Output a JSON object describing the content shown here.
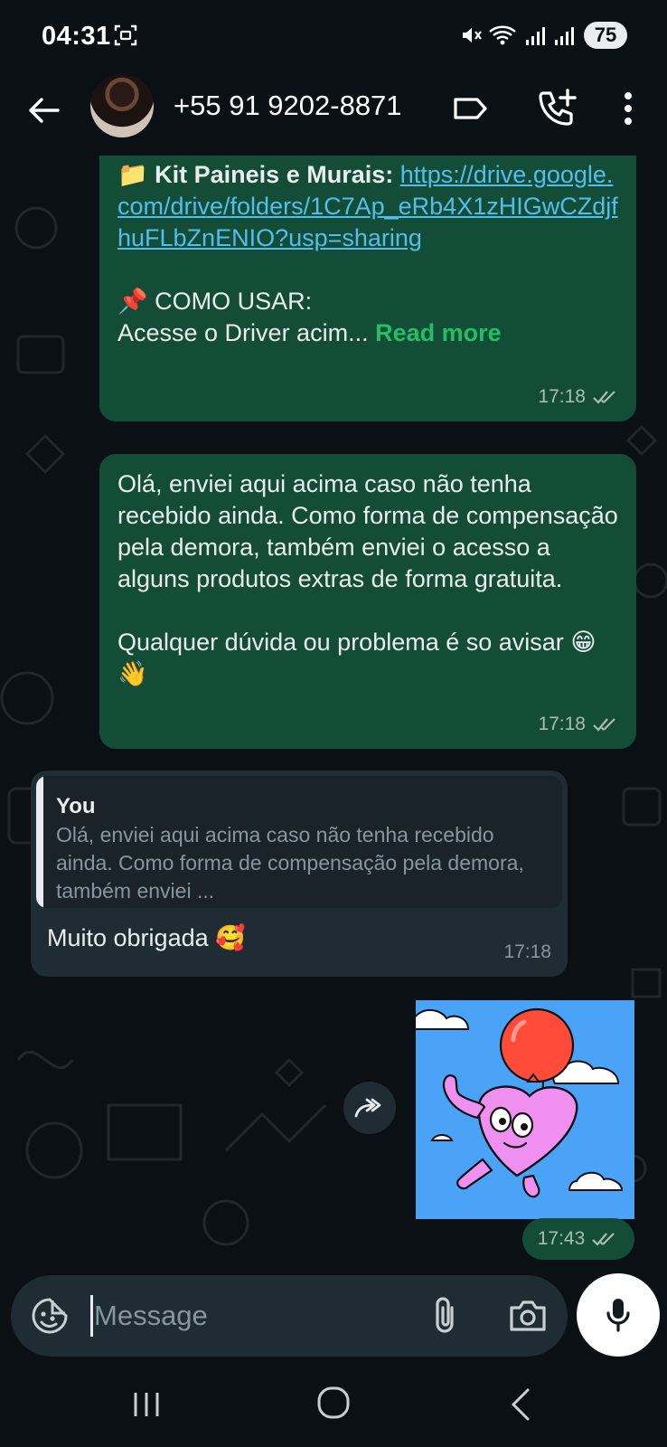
{
  "status_bar": {
    "time": "04:31",
    "battery": "75"
  },
  "header": {
    "contact_name": "+55 91 9202-8871"
  },
  "messages": [
    {
      "folder_emoji": "📁",
      "title": "Kit Paineis e Murais:",
      "link": "https://drive.google.com/drive/folders/1C7Ap_eRb4X1zHIGwCZdjfhuFLbZnENIO?usp=sharing",
      "pin_emoji": "📌",
      "heading": "COMO USAR:",
      "preview": "Acesse o Driver acim...",
      "read_more": "Read more",
      "time": "17:18"
    },
    {
      "paragraph1": "Olá, enviei aqui acima caso não tenha recebido ainda. Como forma de compensação pela demora, também enviei o acesso a alguns produtos extras de forma gratuita.",
      "paragraph2": "Qualquer dúvida ou problema é so avisar",
      "emojis": "😁👋",
      "time": "17:18"
    },
    {
      "quote_author": "You",
      "quote_text": "Olá, enviei aqui acima caso não tenha recebido ainda. Como forma de compensação pela demora, também enviei ...",
      "text": "Muito obrigada",
      "emoji": "🥰",
      "time": "17:18"
    },
    {
      "type": "sticker",
      "time": "17:43"
    }
  ],
  "input": {
    "placeholder": "Message"
  },
  "colors": {
    "background": "#0b1014",
    "outgoing_bubble": "#144d37",
    "incoming_bubble": "#1f2c34",
    "link": "#53bdeb",
    "read_more": "#21c063"
  },
  "icons": [
    "back-arrow-icon",
    "label-icon",
    "add-call-icon",
    "more-vert-icon",
    "double-check-icon",
    "forward-icon",
    "emoji-sticker-icon",
    "attach-icon",
    "camera-icon",
    "mic-icon",
    "nav-recent-icon",
    "nav-home-icon",
    "nav-back-icon"
  ]
}
